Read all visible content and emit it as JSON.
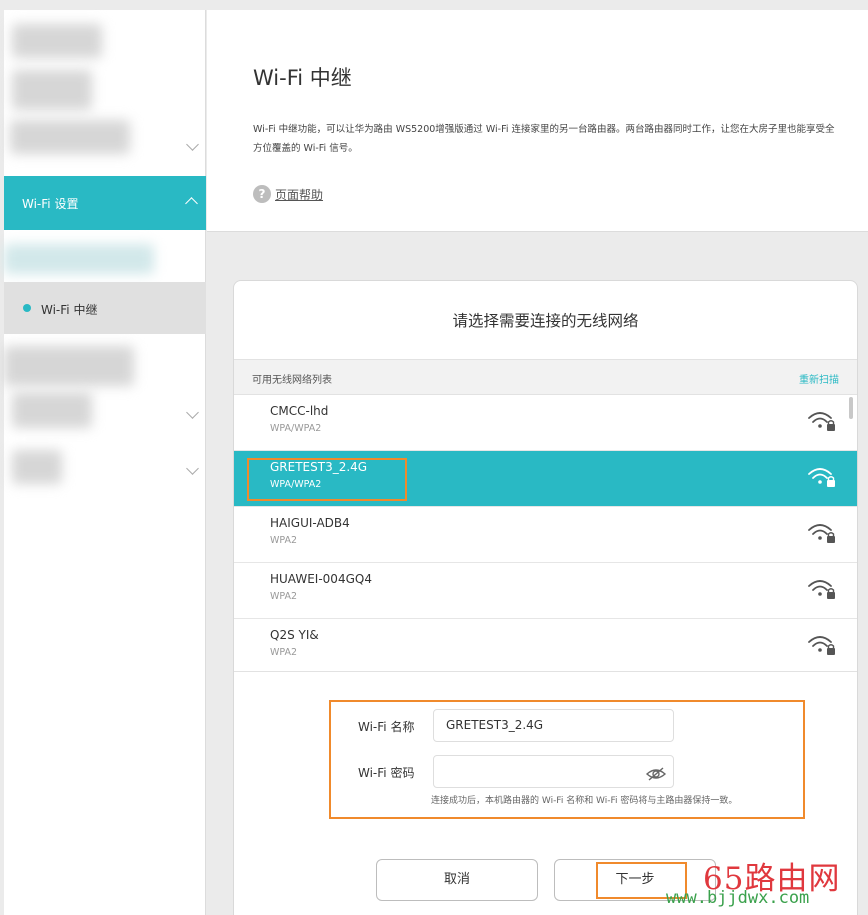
{
  "sidebar": {
    "active_label": "Wi-Fi 设置",
    "sub_item_label": "Wi-Fi 中继"
  },
  "header": {
    "title": "Wi-Fi 中继",
    "description": "Wi-Fi 中继功能，可以让华为路由 WS5200增强版通过 Wi-Fi 连接家里的另一台路由器。两台路由器同时工作，让您在大房子里也能享受全方位覆盖的 Wi-Fi 信号。",
    "help_label": "页面帮助"
  },
  "card": {
    "title": "请选择需要连接的无线网络",
    "list_header": "可用无线网络列表",
    "rescan_label": "重新扫描",
    "networks": [
      {
        "name": "CMCC-lhd",
        "security": "WPA/WPA2"
      },
      {
        "name": "GRETEST3_2.4G",
        "security": "WPA/WPA2"
      },
      {
        "name": "HAIGUI-ADB4",
        "security": "WPA2"
      },
      {
        "name": "HUAWEI-004GQ4",
        "security": "WPA2"
      },
      {
        "name": "Q2S YI&",
        "security": "WPA2"
      }
    ],
    "selected_network": "GRETEST3_2.4G"
  },
  "form": {
    "wifi_name_label": "Wi-Fi 名称",
    "wifi_name_value": "GRETEST3_2.4G",
    "wifi_password_label": "Wi-Fi 密码",
    "wifi_password_value": "",
    "hint": "连接成功后，本机路由器的 Wi-Fi 名称和 Wi-Fi 密码将与主路由器保持一致。"
  },
  "buttons": {
    "cancel_label": "取消",
    "next_label": "下一步"
  },
  "watermark": {
    "main": "65路由网",
    "sub": "www.bjjdwx.com"
  },
  "colors": {
    "accent": "#29b9c4",
    "highlight_box": "#f08a2c",
    "watermark_red": "#e0383e",
    "watermark_green": "#3aa14c"
  }
}
